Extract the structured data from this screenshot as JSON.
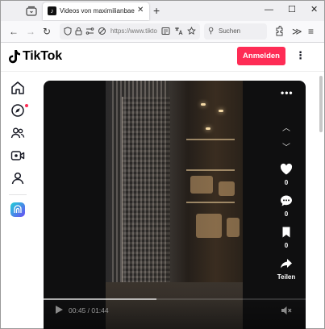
{
  "browser": {
    "tab_title": "Videos von maximilianbaehring",
    "tab_favicon": "♪",
    "tab_close": "✕",
    "new_tab": "+",
    "window_min": "—",
    "window_max": "☐",
    "window_close": "✕",
    "url": "https://www.tiktok.com",
    "search_placeholder": "Suchen",
    "back": "←",
    "forward": "→",
    "reload": "↻",
    "overflow": "≫",
    "menu": "≡"
  },
  "header": {
    "logo_text": "TikTok",
    "login_label": "Anmelden",
    "more_label": "⋮"
  },
  "sidebar": {
    "items": [
      {
        "name": "home",
        "icon": "home-icon"
      },
      {
        "name": "explore",
        "icon": "compass-icon",
        "has_dot": true
      },
      {
        "name": "following",
        "icon": "people-icon"
      },
      {
        "name": "live",
        "icon": "live-icon"
      },
      {
        "name": "profile",
        "icon": "person-icon"
      }
    ]
  },
  "player": {
    "more_label": "•••",
    "prev_label": "︿",
    "next_label": "﹀",
    "like_count": "0",
    "comment_count": "0",
    "bookmark_count": "0",
    "share_label": "Teilen",
    "time": "00:45 / 01:44",
    "progress": 0.43
  },
  "colors": {
    "accent": "#fe2c55",
    "text": "#161823"
  }
}
